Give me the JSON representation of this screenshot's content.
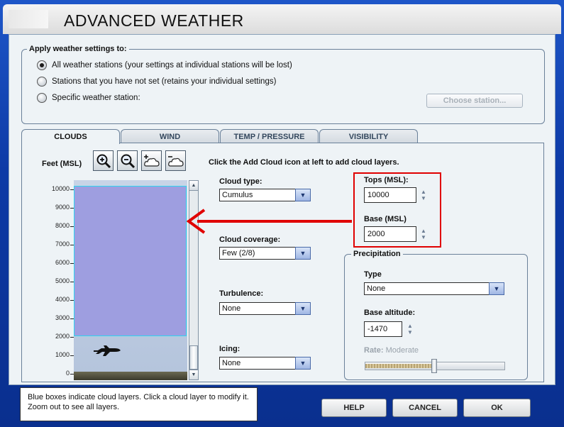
{
  "window": {
    "title": "ADVANCED WEATHER"
  },
  "apply_group": {
    "label": "Apply weather settings to:",
    "options": [
      {
        "label": "All weather stations (your settings at individual stations will be lost)",
        "selected": true
      },
      {
        "label": "Stations that you have not set (retains your individual settings)",
        "selected": false
      },
      {
        "label": "Specific weather station:",
        "selected": false
      }
    ],
    "choose_station_label": "Choose station..."
  },
  "tabs": [
    {
      "label": "CLOUDS",
      "active": true
    },
    {
      "label": "WIND",
      "active": false
    },
    {
      "label": "TEMP / PRESSURE",
      "active": false
    },
    {
      "label": "VISIBILITY",
      "active": false
    }
  ],
  "clouds": {
    "feet_label": "Feet (MSL)",
    "instruction": "Click the Add Cloud icon at left to add cloud layers.",
    "zoom_icons": [
      "zoom-in-icon",
      "zoom-out-icon",
      "add-cloud-icon",
      "remove-cloud-icon"
    ],
    "axis_ticks": [
      "10000",
      "9000",
      "8000",
      "7000",
      "6000",
      "5000",
      "4000",
      "3000",
      "2000",
      "1000",
      "0"
    ],
    "cloud_type": {
      "label": "Cloud type:",
      "value": "Cumulus"
    },
    "cloud_coverage": {
      "label": "Cloud coverage:",
      "value": "Few (2/8)"
    },
    "turbulence": {
      "label": "Turbulence:",
      "value": "None"
    },
    "icing": {
      "label": "Icing:",
      "value": "None"
    },
    "tops": {
      "label": "Tops (MSL):",
      "value": "10000"
    },
    "base": {
      "label": "Base (MSL)",
      "value": "2000"
    },
    "precipitation": {
      "label": "Precipitation",
      "type_label": "Type",
      "type_value": "None",
      "base_altitude_label": "Base altitude:",
      "base_altitude_value": "-1470",
      "rate_label": "Rate:",
      "rate_value": "Moderate"
    },
    "cloud_layer": {
      "tops_ft": 10000,
      "base_ft": 2000
    },
    "axis_range_ft": [
      0,
      10000
    ]
  },
  "info": {
    "text": "Blue boxes indicate cloud layers. Click a cloud layer to modify it. Zoom out to see all layers."
  },
  "buttons": {
    "help": "HELP",
    "cancel": "CANCEL",
    "ok": "OK"
  },
  "colors": {
    "window_frame": "#0d3aa6",
    "cloud_layer": "#9e9ee0",
    "annotation_red": "#e00000"
  }
}
